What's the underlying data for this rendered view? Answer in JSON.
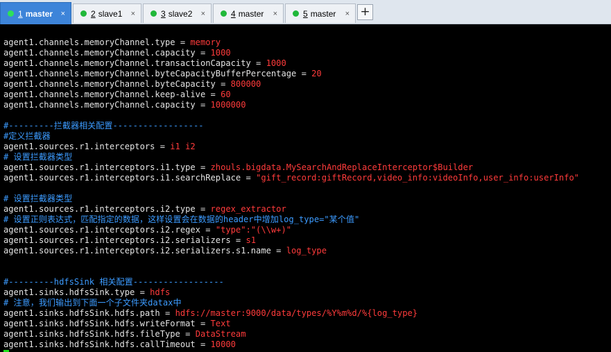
{
  "tabs": [
    {
      "num": "1",
      "label": "master",
      "active": true
    },
    {
      "num": "2",
      "label": "slave1",
      "active": false
    },
    {
      "num": "3",
      "label": "slave2",
      "active": false
    },
    {
      "num": "4",
      "label": "master",
      "active": false
    },
    {
      "num": "5",
      "label": "master",
      "active": false
    }
  ],
  "tab_close_glyph": "×",
  "add_tab_glyph": "+",
  "colors": {
    "comment": "#3c9bff",
    "value": "#ff3b3b",
    "text": "#e3e3e3",
    "background": "#000000",
    "active_tab": "#3d84d9",
    "status_dot": "#20b83a"
  },
  "terminal": {
    "lines": [
      {
        "key": "agent1.channels.memoryChannel.type",
        "value": "memory"
      },
      {
        "key": "agent1.channels.memoryChannel.capacity",
        "value": "1000"
      },
      {
        "key": "agent1.channels.memoryChannel.transactionCapacity",
        "value": "1000"
      },
      {
        "key": "agent1.channels.memoryChannel.byteCapacityBufferPercentage",
        "value": "20"
      },
      {
        "key": "agent1.channels.memoryChannel.byteCapacity",
        "value": "800000"
      },
      {
        "key": "agent1.channels.memoryChannel.keep-alive",
        "value": "60"
      },
      {
        "key": "agent1.channels.memoryChannel.capacity",
        "value": "1000000"
      },
      {
        "blank": true
      },
      {
        "comment": "#---------拦截器相关配置------------------"
      },
      {
        "comment": "#定义拦截器"
      },
      {
        "key": "agent1.sources.r1.interceptors",
        "value": "i1 i2"
      },
      {
        "comment": "# 设置拦截器类型"
      },
      {
        "key": "agent1.sources.r1.interceptors.i1.type",
        "value": "zhouls.bigdata.MySearchAndReplaceInterceptor$Builder"
      },
      {
        "key": "agent1.sources.r1.interceptors.i1.searchReplace",
        "value": "\"gift_record:giftRecord,video_info:videoInfo,user_info:userInfo\""
      },
      {
        "blank": true
      },
      {
        "comment": "# 设置拦截器类型"
      },
      {
        "key": "agent1.sources.r1.interceptors.i2.type",
        "value": "regex_extractor"
      },
      {
        "comment": "# 设置正则表达式，匹配指定的数据，这样设置会在数据的header中增加log_type=\"某个值\""
      },
      {
        "key": "agent1.sources.r1.interceptors.i2.regex",
        "value": "\"type\":\"(\\\\w+)\""
      },
      {
        "key": "agent1.sources.r1.interceptors.i2.serializers",
        "value": "s1"
      },
      {
        "key": "agent1.sources.r1.interceptors.i2.serializers.s1.name",
        "value": "log_type"
      },
      {
        "blank": true
      },
      {
        "blank": true
      },
      {
        "comment": "#---------hdfsSink 相关配置------------------"
      },
      {
        "key": "agent1.sinks.hdfsSink.type",
        "value": "hdfs"
      },
      {
        "comment": "# 注意，我们输出到下面一个子文件夹datax中"
      },
      {
        "key": "agent1.sinks.hdfsSink.hdfs.path",
        "value": "hdfs://master:9000/data/types/%Y%m%d/%{log_type}"
      },
      {
        "key": "agent1.sinks.hdfsSink.hdfs.writeFormat",
        "value": "Text"
      },
      {
        "key": "agent1.sinks.hdfsSink.hdfs.fileType",
        "value": "DataStream"
      },
      {
        "key": "agent1.sinks.hdfsSink.hdfs.callTimeout",
        "value": "10000"
      }
    ]
  }
}
